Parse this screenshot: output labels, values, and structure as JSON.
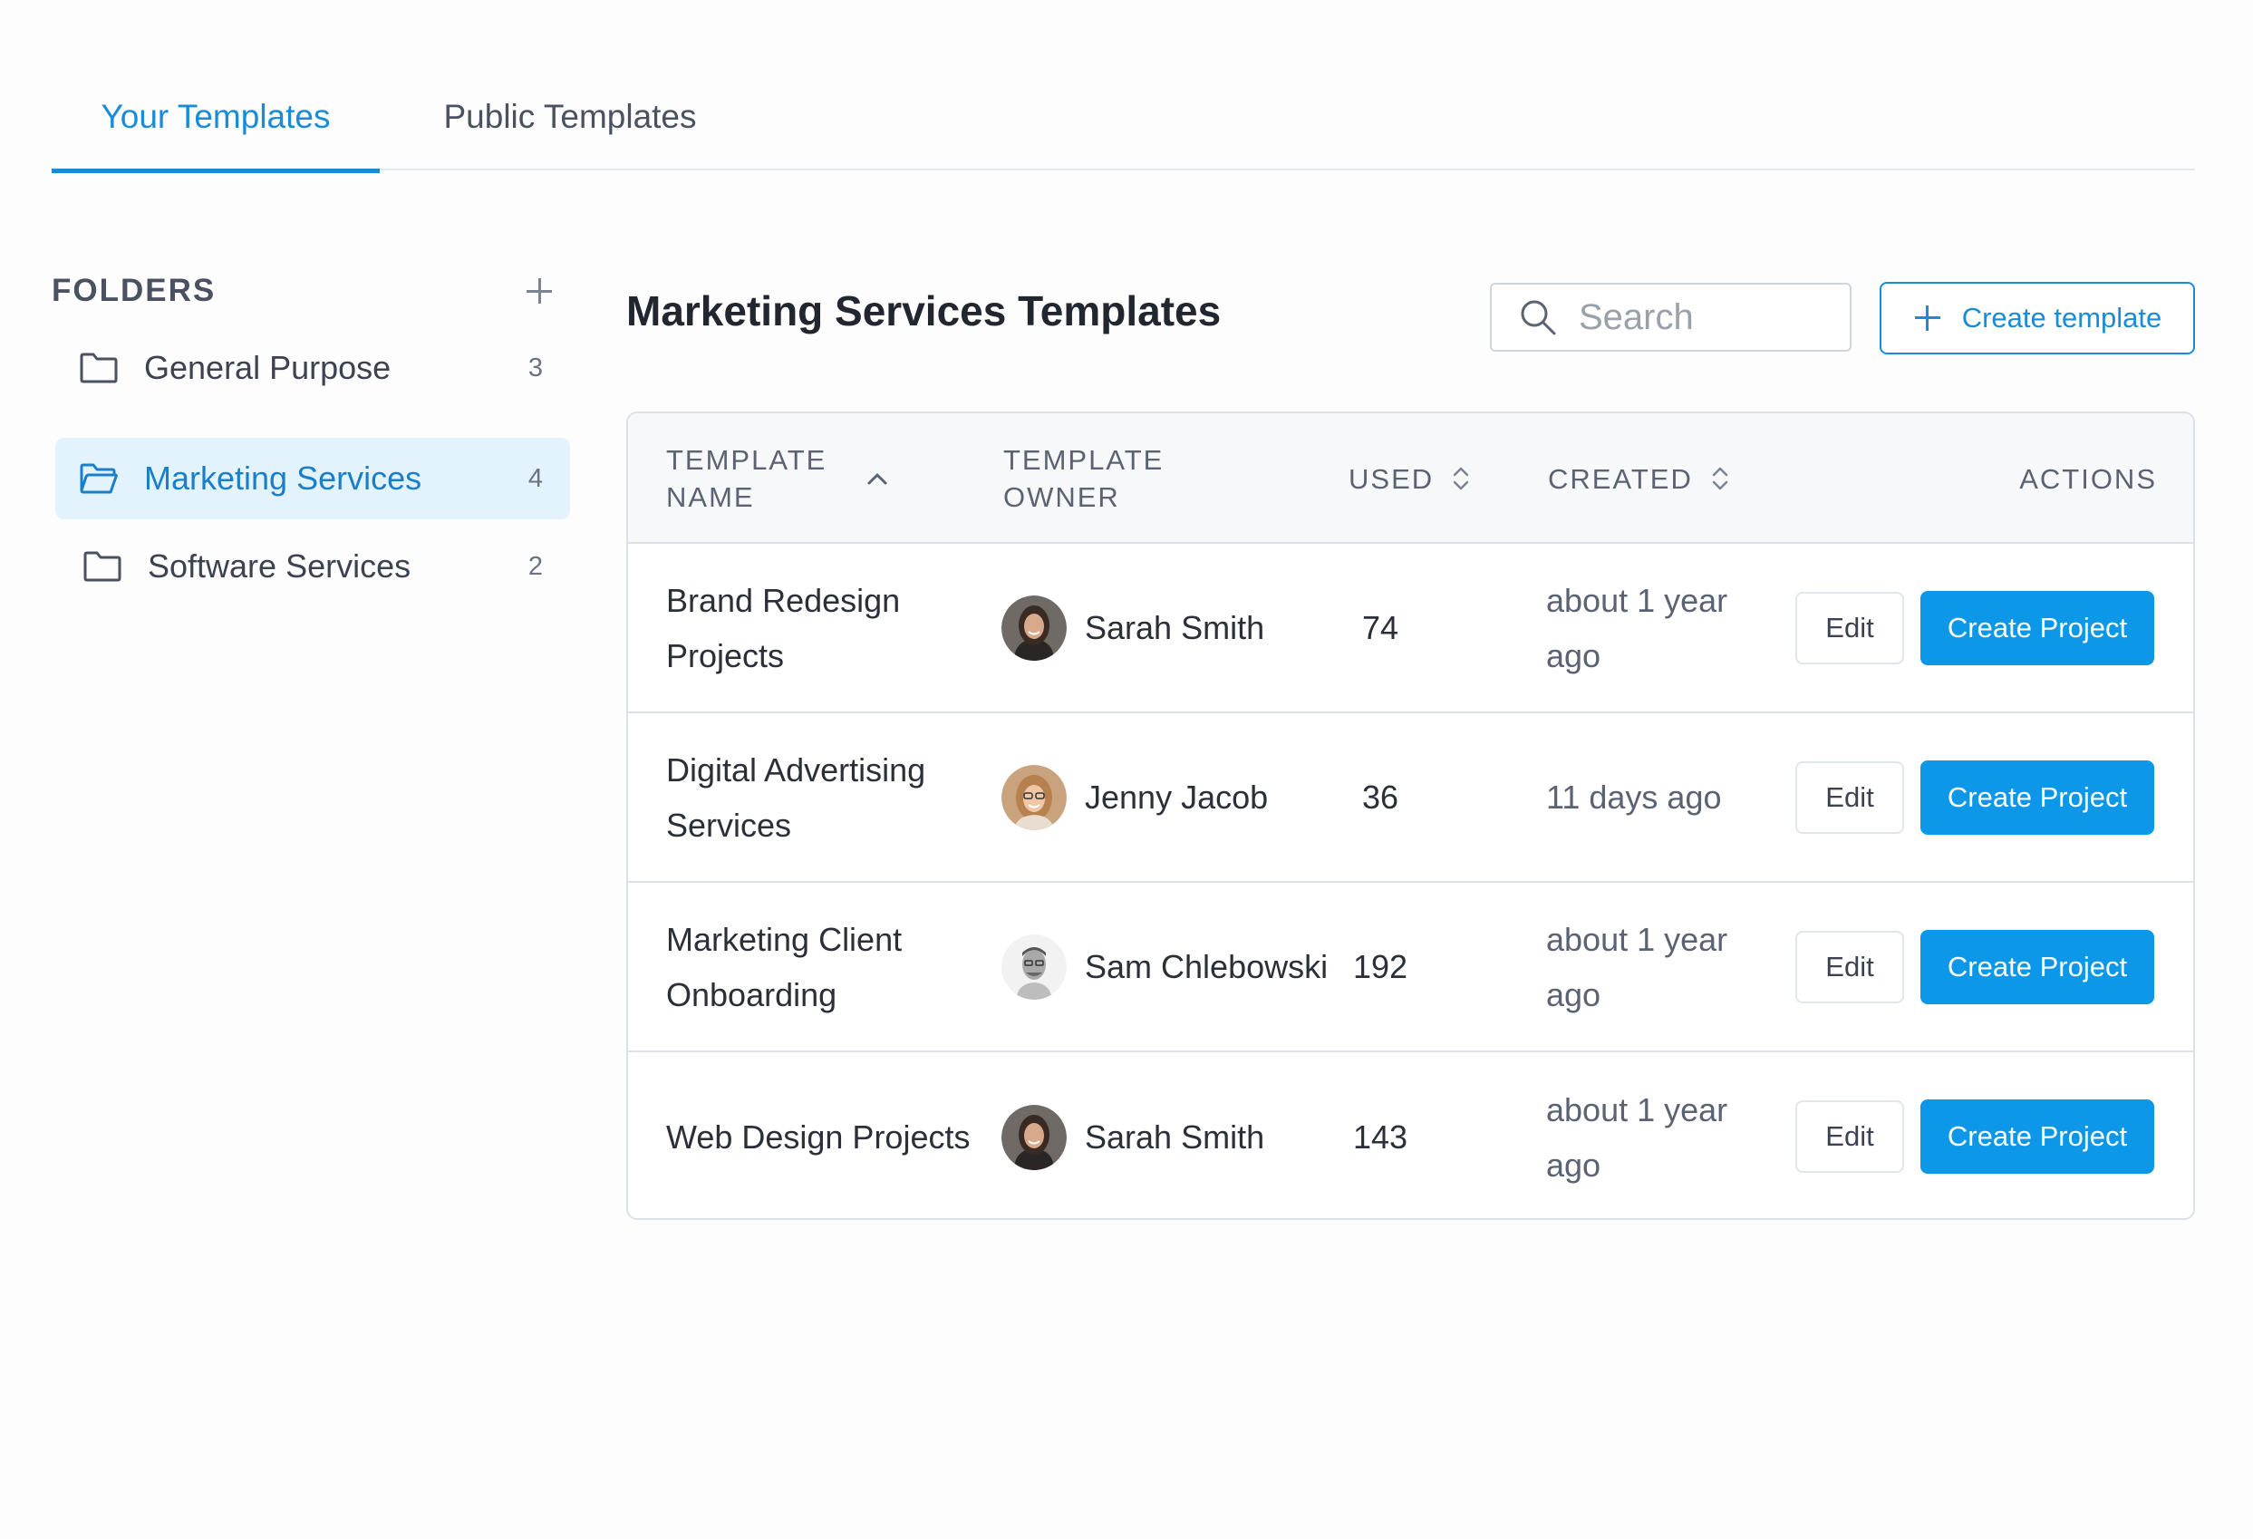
{
  "tabs": [
    {
      "label": "Your Templates",
      "active": true
    },
    {
      "label": "Public Templates",
      "active": false
    }
  ],
  "sidebar": {
    "title": "FOLDERS",
    "folders": [
      {
        "label": "General Purpose",
        "count": "3",
        "active": false
      },
      {
        "label": "Marketing Services",
        "count": "4",
        "active": true
      },
      {
        "label": "Software Services",
        "count": "2",
        "active": false
      }
    ]
  },
  "main": {
    "title": "Marketing Services Templates",
    "search_placeholder": "Search",
    "create_template_label": "Create template"
  },
  "table": {
    "headers": {
      "name_line1": "TEMPLATE",
      "name_line2": "NAME",
      "owner_line1": "TEMPLATE",
      "owner_line2": "OWNER",
      "used": "USED",
      "created": "CREATED",
      "actions": "ACTIONS"
    },
    "rows": [
      {
        "name": "Brand Redesign Projects",
        "owner": "Sarah Smith",
        "used": "74",
        "created": "about 1 year ago",
        "edit": "Edit",
        "create": "Create Project"
      },
      {
        "name": "Digital Advertising Services",
        "owner": "Jenny Jacob",
        "used": "36",
        "created": "11 days ago",
        "edit": "Edit",
        "create": "Create Project"
      },
      {
        "name": "Marketing Client Onboarding",
        "owner": "Sam Chlebowski",
        "used": "192",
        "created": "about 1 year ago",
        "edit": "Edit",
        "create": "Create Project"
      },
      {
        "name": "Web Design Projects",
        "owner": "Sarah Smith",
        "used": "143",
        "created": "about 1 year ago",
        "edit": "Edit",
        "create": "Create Project"
      }
    ]
  },
  "colors": {
    "accent": "#1a8bd6",
    "primary_button": "#0c97e8",
    "active_folder_bg": "#e3f3fd"
  }
}
